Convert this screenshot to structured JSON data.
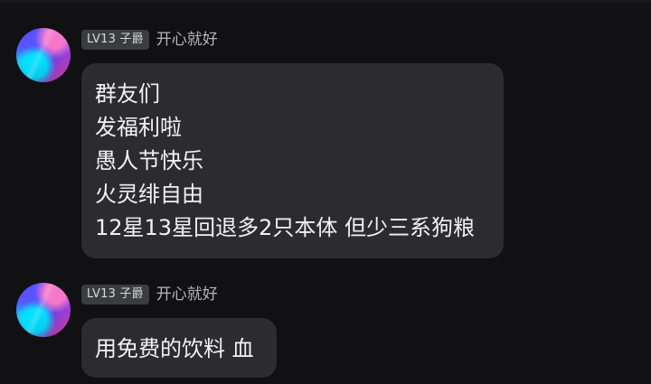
{
  "messages": [
    {
      "level": "LV13 子爵",
      "username": "开心就好",
      "lines": [
        "群友们",
        "发福利啦",
        "愚人节快乐",
        "火灵绯自由",
        "12星13星回退多2只本体 但少三系狗粮"
      ]
    },
    {
      "level": "LV13 子爵",
      "username": "开心就好",
      "lines": [
        "用免费的饮料 血"
      ]
    }
  ]
}
